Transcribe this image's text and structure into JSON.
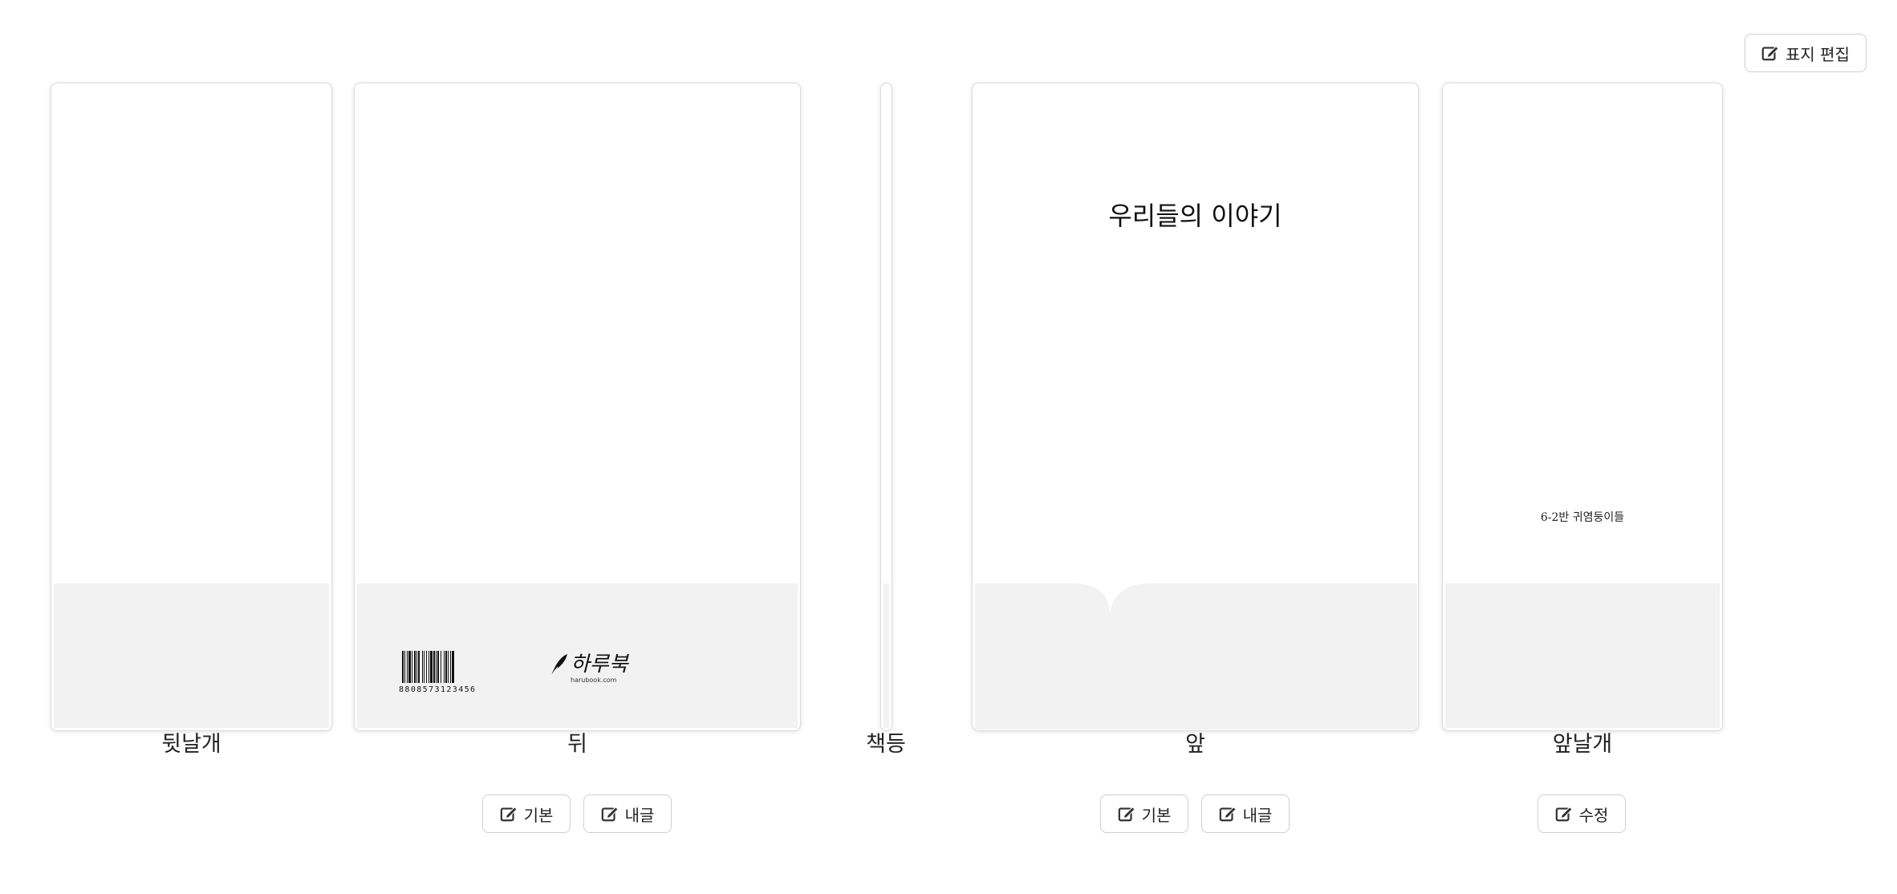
{
  "toolbar": {
    "edit_cover_label": "표지 편집",
    "edit_cover_icon": "edit-icon"
  },
  "panels": {
    "back_flap": {
      "label": "뒷날개"
    },
    "back": {
      "label": "뒤",
      "barcode_number": "8808573123456",
      "logo_text": "하루북",
      "logo_url": "harubook.com"
    },
    "spine": {
      "label": "책등"
    },
    "front": {
      "label": "앞",
      "title": "우리들의 이야기"
    },
    "front_flap": {
      "label": "앞날개",
      "author": "6-2반 귀염둥이들"
    }
  },
  "buttons": {
    "back_basic": "기본",
    "back_text": "내글",
    "front_basic": "기본",
    "front_text": "내글",
    "front_flap_edit": "수정"
  },
  "colors": {
    "panel_bottom": "#f2f2f2",
    "border": "#dcdcdc"
  }
}
